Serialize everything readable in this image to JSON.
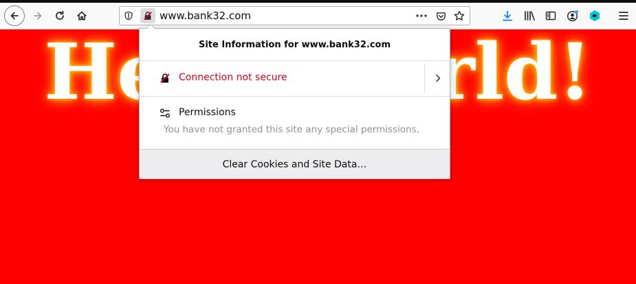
{
  "browser": {
    "url": "www.bank32.com"
  },
  "page": {
    "heading": "Hello World!",
    "background": "#ff0000"
  },
  "site_info_panel": {
    "title": "Site Information for www.bank32.com",
    "connection_label": "Connection not secure",
    "permissions_label": "Permissions",
    "permissions_desc": "You have not granted this site any special permissions.",
    "clear_button": "Clear Cookies and Site Data…"
  },
  "colors": {
    "insecure": "#d70022",
    "download_icon": "#0a84ff",
    "badge": "#45a1ff"
  }
}
